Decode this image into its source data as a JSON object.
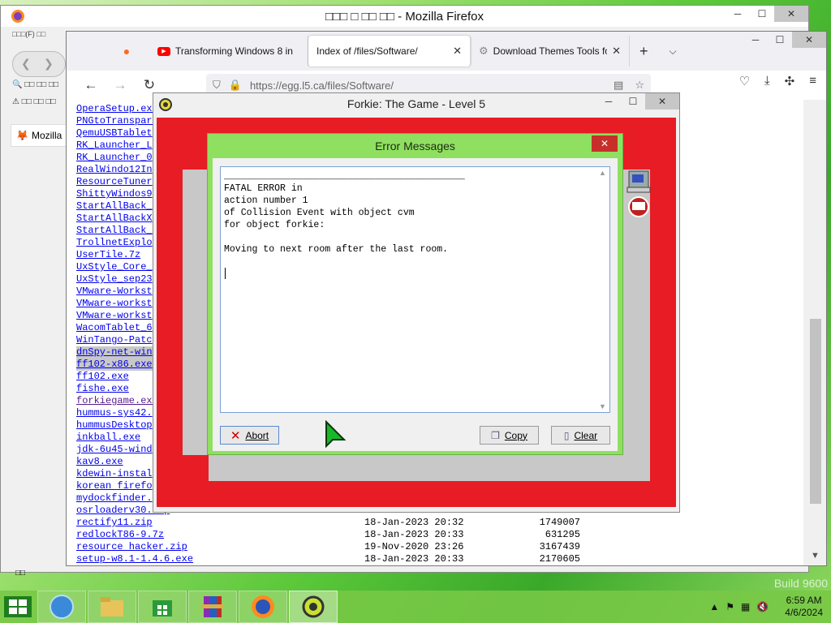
{
  "back_window": {
    "title": "□□□ □ □□ □□ - Mozilla Firefox",
    "menu_strip": "□□□(F) □□",
    "side_icons": "□□ □□ □□",
    "sidebar_label": "Mozilla",
    "status_glyph": "□□"
  },
  "browser": {
    "tabs": [
      {
        "label": "",
        "icon": "firefox-icon"
      },
      {
        "label": "Transforming Windows 8 in",
        "icon": "youtube-icon"
      },
      {
        "label": "Index of /files/Software/",
        "icon": "none",
        "active": true
      },
      {
        "label": "Download Themes Tools fo",
        "icon": "settings-page-icon"
      }
    ],
    "url": "https://egg.l5.ca/files/Software/"
  },
  "file_listing": [
    {
      "name": "OperaSetup.exe",
      "date": "",
      "size": ""
    },
    {
      "name": "PNGtoTransparent",
      "date": "",
      "size": ""
    },
    {
      "name": "QemuUSBTablet",
      "date": "",
      "size": ""
    },
    {
      "name": "RK_Launcher_L",
      "date": "",
      "size": ""
    },
    {
      "name": "RK_Launcher_0",
      "date": "",
      "size": ""
    },
    {
      "name": "RealWindo12In",
      "date": "",
      "size": ""
    },
    {
      "name": "ResourceTuner",
      "date": "",
      "size": ""
    },
    {
      "name": "ShittyWindos9",
      "date": "",
      "size": ""
    },
    {
      "name": "StartAllBack_",
      "date": "",
      "size": ""
    },
    {
      "name": "StartAllBackX",
      "date": "",
      "size": ""
    },
    {
      "name": "StartAllBack_",
      "date": "",
      "size": ""
    },
    {
      "name": "TrollnetExplo",
      "date": "",
      "size": ""
    },
    {
      "name": "UserTile.7z",
      "date": "",
      "size": ""
    },
    {
      "name": "UxStyle_Core_",
      "date": "",
      "size": ""
    },
    {
      "name": "UxStyle_sep23",
      "date": "",
      "size": ""
    },
    {
      "name": "VMware-Workst",
      "date": "",
      "size": ""
    },
    {
      "name": "VMware-workst",
      "date": "",
      "size": ""
    },
    {
      "name": "VMware-workst",
      "date": "",
      "size": ""
    },
    {
      "name": "WacomTablet_6",
      "date": "",
      "size": ""
    },
    {
      "name": "WinTango-Patc",
      "date": "",
      "size": ""
    },
    {
      "name": "dnSpy-net-win",
      "date": "",
      "size": "",
      "selected": true
    },
    {
      "name": "ff102-x86.exe",
      "date": "",
      "size": "",
      "selected": true
    },
    {
      "name": "ff102.exe",
      "date": "",
      "size": ""
    },
    {
      "name": "fishe.exe",
      "date": "",
      "size": ""
    },
    {
      "name": "forkiegame.exe",
      "date": "",
      "size": "",
      "visited": true
    },
    {
      "name": "hummus-sys42.",
      "date": "",
      "size": ""
    },
    {
      "name": "hummusDesktop",
      "date": "",
      "size": ""
    },
    {
      "name": "inkball.exe",
      "date": "",
      "size": ""
    },
    {
      "name": "jdk-6u45-wind",
      "date": "",
      "size": ""
    },
    {
      "name": "kav8.exe",
      "date": "",
      "size": ""
    },
    {
      "name": "kdewin-instal",
      "date": "",
      "size": ""
    },
    {
      "name": "korean firefo",
      "date": "",
      "size": ""
    },
    {
      "name": "mydockfinder.",
      "date": "",
      "size": ""
    },
    {
      "name": "osrloaderv30.zip",
      "date": "",
      "size": ""
    },
    {
      "name": "rectify11.zip",
      "date": "18-Jan-2023 20:32",
      "size": "1749007"
    },
    {
      "name": "redlockT86-9.7z",
      "date": "18-Jan-2023 20:33",
      "size": "631295"
    },
    {
      "name": "resource hacker.zip",
      "date": "19-Nov-2020 23:26",
      "size": "3167439"
    },
    {
      "name": "setup-w8.1-1.4.6.exe",
      "date": "18-Jan-2023 20:33",
      "size": "2170605"
    }
  ],
  "game_window": {
    "title": "Forkie: The Game - Level 5"
  },
  "error_dialog": {
    "title": "Error Messages",
    "divider": "___________________________________________",
    "lines": [
      "FATAL ERROR in",
      "action number 1",
      "of Collision Event with object cvm",
      "for object forkie:",
      "",
      "Moving to next room after the last room."
    ],
    "buttons": {
      "abort": "Abort",
      "copy": "Copy",
      "clear": "Clear"
    }
  },
  "taskbar": {
    "time": "6:59 AM",
    "date": "4/6/2024"
  },
  "desktop": {
    "build_text": "Build 9600"
  },
  "colors": {
    "desktop_green": "#5cc83a",
    "game_red": "#e81c24",
    "dialog_green": "#8fe060",
    "link_blue": "#0000ee",
    "close_red": "#c7302a"
  }
}
